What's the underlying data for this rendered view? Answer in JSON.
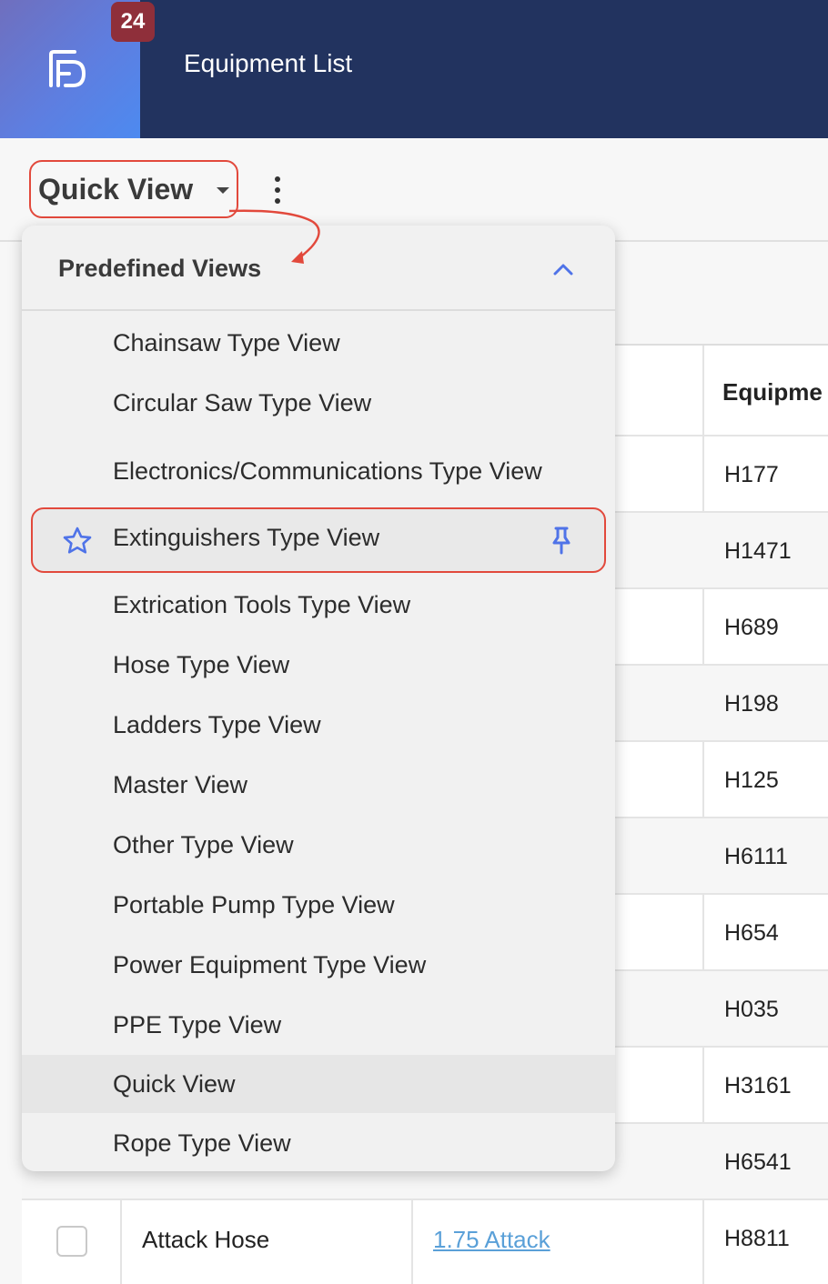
{
  "header": {
    "notification_count": "24",
    "title": "Equipment List",
    "logo_icon": "brand-logo-icon"
  },
  "toolbar": {
    "quick_view_label": "Quick View",
    "menu_icon": "kebab-icon"
  },
  "dropdown": {
    "section_title": "Predefined Views",
    "items": [
      "Chainsaw Type View",
      "Circular Saw Type View",
      "Electronics/Communications Type View",
      "Extinguishers Type View",
      "Extrication Tools Type View",
      "Hose Type View",
      "Ladders Type View",
      "Master View",
      "Other Type View",
      "Portable Pump Type View",
      "Power Equipment Type View",
      "PPE Type View",
      "Quick View",
      "Rope Type View"
    ]
  },
  "table": {
    "equipment_header": "Equipme",
    "ids": [
      "H177",
      "H1471",
      "H689",
      "H198",
      "H125",
      "H6111",
      "H654",
      "H035",
      "H3161",
      "H6541",
      "H8811"
    ],
    "last_row": {
      "name": "Attack Hose",
      "link": "1.75 Attack"
    }
  },
  "colors": {
    "header_bg": "#22335f",
    "highlight_border": "#e2493c",
    "accent_blue": "#4f73e8",
    "link": "#5aa0d8"
  }
}
